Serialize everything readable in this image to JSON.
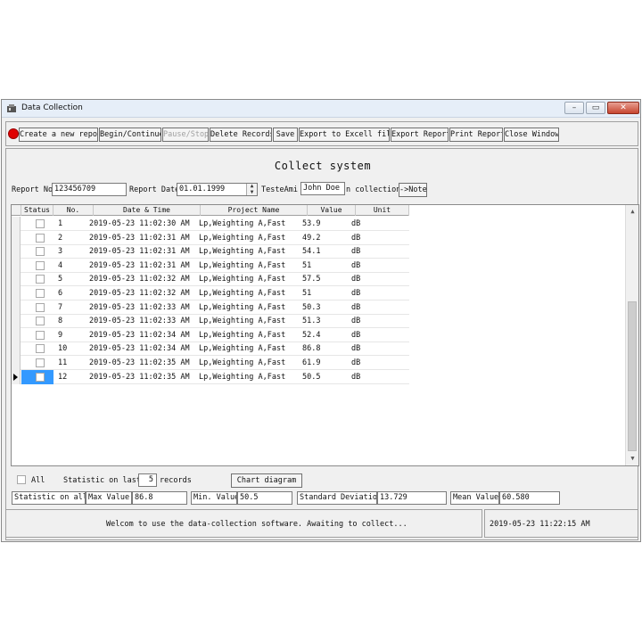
{
  "window": {
    "title": "Data Collection",
    "close_glyph": "✕",
    "min_glyph": "–",
    "max_glyph": "▭"
  },
  "toolbar": {
    "record_indicator_color": "#e00000",
    "buttons": [
      {
        "label": "Create a new report",
        "enabled": true
      },
      {
        "label": "Begin/Continue",
        "enabled": true
      },
      {
        "label": "Pause/Stop",
        "enabled": false
      },
      {
        "label": "Delete Records",
        "enabled": true
      },
      {
        "label": "Save",
        "enabled": true
      },
      {
        "label": "Export to Excell file",
        "enabled": true
      },
      {
        "label": "Export Report",
        "enabled": true
      },
      {
        "label": "Print Report",
        "enabled": true
      },
      {
        "label": "Close Window",
        "enabled": true
      }
    ]
  },
  "header": {
    "title": "Collect system",
    "report_no_label": "Report No",
    "report_no_value": "123456709",
    "report_date_label": "Report Date",
    "report_date_value": "01.01.1999",
    "tester_label": "TesteAmi",
    "tester_value": "John Doe",
    "collection_label": "n collection",
    "note_button": "->Note"
  },
  "grid": {
    "columns": [
      "Status",
      "No.",
      "Date & Time",
      "Project Name",
      "Value",
      "Unit"
    ],
    "rows": [
      {
        "no": "1",
        "datetime": "2019-05-23 11:02:30 AM",
        "project": "Lp,Weighting A,Fast",
        "value": "53.9",
        "unit": "dB"
      },
      {
        "no": "2",
        "datetime": "2019-05-23 11:02:31 AM",
        "project": "Lp,Weighting A,Fast",
        "value": "49.2",
        "unit": "dB"
      },
      {
        "no": "3",
        "datetime": "2019-05-23 11:02:31 AM",
        "project": "Lp,Weighting A,Fast",
        "value": "54.1",
        "unit": "dB"
      },
      {
        "no": "4",
        "datetime": "2019-05-23 11:02:31 AM",
        "project": "Lp,Weighting A,Fast",
        "value": "51",
        "unit": "dB"
      },
      {
        "no": "5",
        "datetime": "2019-05-23 11:02:32 AM",
        "project": "Lp,Weighting A,Fast",
        "value": "57.5",
        "unit": "dB"
      },
      {
        "no": "6",
        "datetime": "2019-05-23 11:02:32 AM",
        "project": "Lp,Weighting A,Fast",
        "value": "51",
        "unit": "dB"
      },
      {
        "no": "7",
        "datetime": "2019-05-23 11:02:33 AM",
        "project": "Lp,Weighting A,Fast",
        "value": "50.3",
        "unit": "dB"
      },
      {
        "no": "8",
        "datetime": "2019-05-23 11:02:33 AM",
        "project": "Lp,Weighting A,Fast",
        "value": "51.3",
        "unit": "dB"
      },
      {
        "no": "9",
        "datetime": "2019-05-23 11:02:34 AM",
        "project": "Lp,Weighting A,Fast",
        "value": "52.4",
        "unit": "dB"
      },
      {
        "no": "10",
        "datetime": "2019-05-23 11:02:34 AM",
        "project": "Lp,Weighting A,Fast",
        "value": "86.8",
        "unit": "dB"
      },
      {
        "no": "11",
        "datetime": "2019-05-23 11:02:35 AM",
        "project": "Lp,Weighting A,Fast",
        "value": "61.9",
        "unit": "dB"
      },
      {
        "no": "12",
        "datetime": "2019-05-23 11:02:35 AM",
        "project": "Lp,Weighting A,Fast",
        "value": "50.5",
        "unit": "dB"
      }
    ],
    "selected_row": 11,
    "selection_color": "#3399ff",
    "scroll_up": "▲",
    "scroll_down": "▼"
  },
  "statistics": {
    "all_label": "All",
    "statistic_on_last_label": "Statistic on last",
    "last_count": "5",
    "records_label": "records",
    "chart_button": "Chart diagram",
    "statistic_on_all": "Statistic on all",
    "max_label": "Max  Value",
    "max_value": "86.8",
    "min_label": "Min. Value",
    "min_value": "50.5",
    "std_label": "Standard Deviation",
    "std_value": "13.729",
    "mean_label": "Mean Value",
    "mean_value": "60.580"
  },
  "status": {
    "message": "Welcom to use the data-collection software. Awaiting to collect...",
    "timestamp": "2019-05-23 11:22:15 AM"
  }
}
